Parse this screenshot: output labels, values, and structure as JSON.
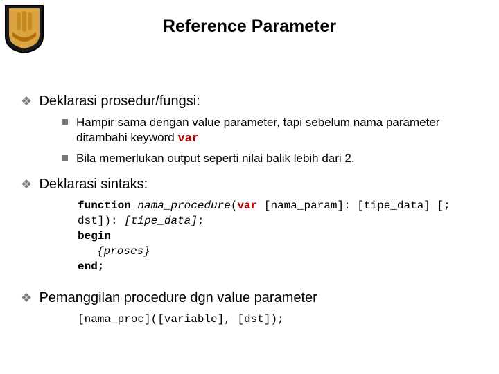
{
  "title": "Reference Parameter",
  "bullets": {
    "a": {
      "head": "Deklarasi prosedur/fungsi:",
      "s1a": "Hampir sama dengan value parameter, tapi sebelum nama parameter ditambahi keyword ",
      "s1b_code": "var",
      "s2": "Bila memerlukan output seperti nilai balik lebih dari 2."
    },
    "b": {
      "head": "Deklarasi sintaks:",
      "code": {
        "l1_kw": "function ",
        "l1_it": "nama_procedure",
        "l1_p1": "(",
        "l1_var": "var",
        "l1_p2": " [nama_param]: [tipe_data] [; dst]): ",
        "l1_it2": "[tipe_data]",
        "l1_p3": ";",
        "l2": "begin",
        "l3": "{proses}",
        "l4": "end;"
      }
    },
    "c": {
      "head": "Pemanggilan procedure dgn value parameter",
      "code": "[nama_proc]([variable], [dst]);"
    }
  }
}
